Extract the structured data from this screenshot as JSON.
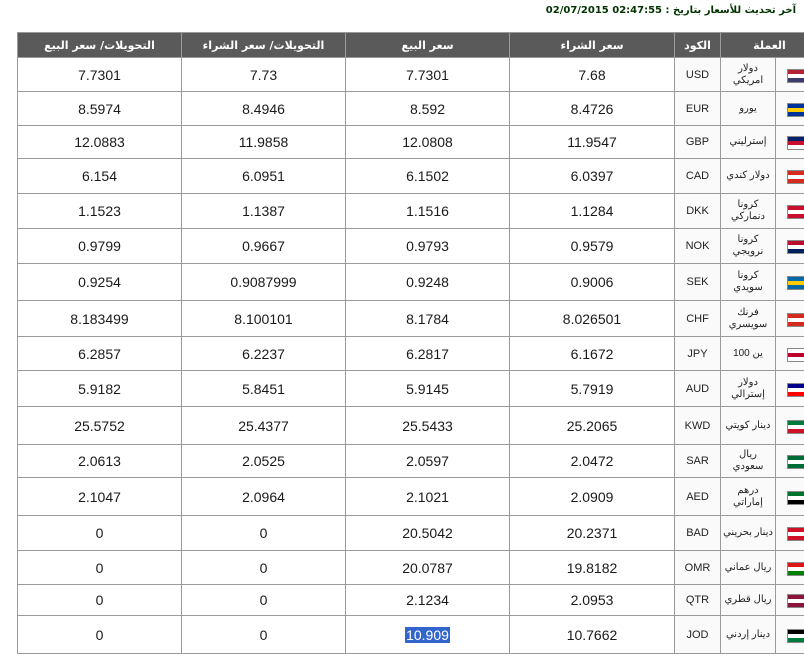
{
  "header": {
    "label": "آخر تحديث للأسعار بتاريخ :",
    "timestamp": "02:47:55 02/07/2015"
  },
  "table": {
    "columns": [
      "العملة",
      "الكود",
      "سعر الشراء",
      "سعر البيع",
      "التحويلات/ سعر الشراء",
      "التحويلات/ سعر البيع"
    ],
    "rows": [
      {
        "flag": "us-flag-icon",
        "colors": [
          "#b22234",
          "#ffffff",
          "#3c3b6e"
        ],
        "name": "دولار امريكي",
        "code": "USD",
        "buy": "7.68",
        "sell": "7.7301",
        "tbuy": "7.73",
        "tsell": "7.7301"
      },
      {
        "flag": "eu-flag-icon",
        "colors": [
          "#003399",
          "#ffcc00",
          "#003399"
        ],
        "name": "يورو",
        "code": "EUR",
        "buy": "8.4726",
        "sell": "8.592",
        "tbuy": "8.4946",
        "tsell": "8.5974"
      },
      {
        "flag": "uk-flag-icon",
        "colors": [
          "#012169",
          "#c8102e",
          "#ffffff"
        ],
        "name": "إسترليني",
        "code": "GBP",
        "buy": "11.9547",
        "sell": "12.0808",
        "tbuy": "11.9858",
        "tsell": "12.0883"
      },
      {
        "flag": "canada-flag-icon",
        "colors": [
          "#d52b1e",
          "#ffffff",
          "#d52b1e"
        ],
        "name": "دولار كندي",
        "code": "CAD",
        "buy": "6.0397",
        "sell": "6.1502",
        "tbuy": "6.0951",
        "tsell": "6.154"
      },
      {
        "flag": "denmark-flag-icon",
        "colors": [
          "#c8102e",
          "#ffffff",
          "#c8102e"
        ],
        "name": "كرونا دنماركي",
        "code": "DKK",
        "buy": "1.1284",
        "sell": "1.1516",
        "tbuy": "1.1387",
        "tsell": "1.1523"
      },
      {
        "flag": "norway-flag-icon",
        "colors": [
          "#ba0c2f",
          "#ffffff",
          "#00205b"
        ],
        "name": "كرونا نرويجي",
        "code": "NOK",
        "buy": "0.9579",
        "sell": "0.9793",
        "tbuy": "0.9667",
        "tsell": "0.9799"
      },
      {
        "flag": "sweden-flag-icon",
        "colors": [
          "#006aa7",
          "#fecc00",
          "#006aa7"
        ],
        "name": "كرونا سويدي",
        "code": "SEK",
        "buy": "0.9006",
        "sell": "0.9248",
        "tbuy": "0.9087999",
        "tsell": "0.9254"
      },
      {
        "flag": "swiss-flag-icon",
        "colors": [
          "#d52b1e",
          "#ffffff",
          "#d52b1e"
        ],
        "name": "فرنك سويسري",
        "code": "CHF",
        "buy": "8.026501",
        "sell": "8.1784",
        "tbuy": "8.100101",
        "tsell": "8.183499"
      },
      {
        "flag": "japan-flag-icon",
        "colors": [
          "#ffffff",
          "#bc002d",
          "#ffffff"
        ],
        "name": "ين 100",
        "code": "JPY",
        "buy": "6.1672",
        "sell": "6.2817",
        "tbuy": "6.2237",
        "tsell": "6.2857"
      },
      {
        "flag": "australia-flag-icon",
        "colors": [
          "#00008b",
          "#ffffff",
          "#ff0000"
        ],
        "name": "دولار إسترالي",
        "code": "AUD",
        "buy": "5.7919",
        "sell": "5.9145",
        "tbuy": "5.8451",
        "tsell": "5.9182"
      },
      {
        "flag": "kuwait-flag-icon",
        "colors": [
          "#007a3d",
          "#ffffff",
          "#ce1126"
        ],
        "name": "دينار كويتي",
        "code": "KWD",
        "buy": "25.2065",
        "sell": "25.5433",
        "tbuy": "25.4377",
        "tsell": "25.5752"
      },
      {
        "flag": "saudi-flag-icon",
        "colors": [
          "#006c35",
          "#ffffff",
          "#006c35"
        ],
        "name": "ريال سعودي",
        "code": "SAR",
        "buy": "2.0472",
        "sell": "2.0597",
        "tbuy": "2.0525",
        "tsell": "2.0613"
      },
      {
        "flag": "uae-flag-icon",
        "colors": [
          "#00732f",
          "#ffffff",
          "#000000"
        ],
        "name": "درهم إماراتي",
        "code": "AED",
        "buy": "2.0909",
        "sell": "2.1021",
        "tbuy": "2.0964",
        "tsell": "2.1047"
      },
      {
        "flag": "bahrain-flag-icon",
        "colors": [
          "#ce1126",
          "#ffffff",
          "#ce1126"
        ],
        "name": "دينار بحريني",
        "code": "BAD",
        "buy": "20.2371",
        "sell": "20.5042",
        "tbuy": "0",
        "tsell": "0"
      },
      {
        "flag": "oman-flag-icon",
        "colors": [
          "#db161b",
          "#ffffff",
          "#008000"
        ],
        "name": "ريال عماني",
        "code": "OMR",
        "buy": "19.8182",
        "sell": "20.0787",
        "tbuy": "0",
        "tsell": "0"
      },
      {
        "flag": "qatar-flag-icon",
        "colors": [
          "#8a1538",
          "#ffffff",
          "#8a1538"
        ],
        "name": "ريال قطري",
        "code": "QTR",
        "buy": "2.0953",
        "sell": "2.1234",
        "tbuy": "0",
        "tsell": "0"
      },
      {
        "flag": "jordan-flag-icon",
        "colors": [
          "#000000",
          "#ffffff",
          "#007a3d"
        ],
        "name": "دينار إردني",
        "code": "JOD",
        "buy": "10.7662",
        "sell": "10.909",
        "tbuy": "0",
        "tsell": "0",
        "sell_highlight": true
      }
    ]
  },
  "colors": {
    "header_bg": "#5a5a5a",
    "border": "#9a9a9a",
    "selection": "#3366cc",
    "update_text": "#003300"
  }
}
